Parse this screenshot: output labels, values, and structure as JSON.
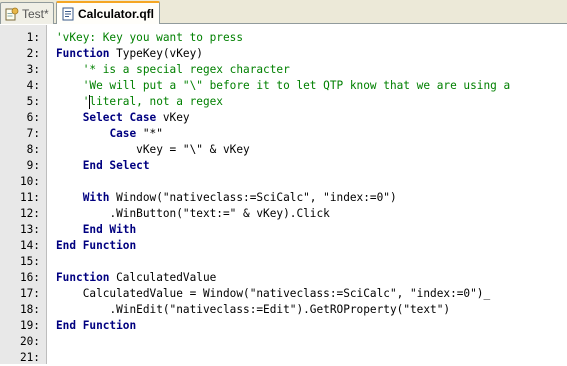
{
  "tabs": [
    {
      "label": "Test*",
      "icon": "script-icon",
      "active": false
    },
    {
      "label": "Calculator.qfl",
      "icon": "function-library-icon",
      "active": true
    }
  ],
  "editor": {
    "lines": [
      {
        "num": "1:",
        "indent": 0,
        "tokens": [
          {
            "t": "'vKey: Key you want to press",
            "c": "cm"
          }
        ]
      },
      {
        "num": "2:",
        "indent": 0,
        "tokens": [
          {
            "t": "Function",
            "c": "kw"
          },
          {
            "t": " TypeKey(vKey)",
            "c": "plain"
          }
        ]
      },
      {
        "num": "3:",
        "indent": 4,
        "tokens": [
          {
            "t": "'* is a special regex character",
            "c": "cm"
          }
        ]
      },
      {
        "num": "4:",
        "indent": 4,
        "tokens": [
          {
            "t": "'We will put a \"\\\" before it to let QTP know that we are using a",
            "c": "cm"
          }
        ]
      },
      {
        "num": "5:",
        "indent": 4,
        "tokens": [
          {
            "t": "'literal, not a regex",
            "c": "cm"
          }
        ]
      },
      {
        "num": "6:",
        "indent": 4,
        "tokens": [
          {
            "t": "Select Case",
            "c": "kw"
          },
          {
            "t": " vKey",
            "c": "plain"
          }
        ]
      },
      {
        "num": "7:",
        "indent": 8,
        "tokens": [
          {
            "t": "Case",
            "c": "kw"
          },
          {
            "t": " \"*\"",
            "c": "plain"
          }
        ]
      },
      {
        "num": "8:",
        "indent": 12,
        "tokens": [
          {
            "t": "vKey = \"\\\" & vKey",
            "c": "plain"
          }
        ]
      },
      {
        "num": "9:",
        "indent": 4,
        "tokens": [
          {
            "t": "End Select",
            "c": "kw"
          }
        ]
      },
      {
        "num": "10:",
        "indent": 0,
        "tokens": []
      },
      {
        "num": "11:",
        "indent": 4,
        "tokens": [
          {
            "t": "With",
            "c": "kw"
          },
          {
            "t": " Window(\"nativeclass:=SciCalc\", \"index:=0\")",
            "c": "plain"
          }
        ]
      },
      {
        "num": "12:",
        "indent": 8,
        "tokens": [
          {
            "t": ".WinButton(\"text:=\" & vKey).Click",
            "c": "plain"
          }
        ]
      },
      {
        "num": "13:",
        "indent": 4,
        "tokens": [
          {
            "t": "End With",
            "c": "kw"
          }
        ]
      },
      {
        "num": "14:",
        "indent": 0,
        "tokens": [
          {
            "t": "End Function",
            "c": "kw"
          }
        ]
      },
      {
        "num": "15:",
        "indent": 0,
        "tokens": []
      },
      {
        "num": "16:",
        "indent": 0,
        "tokens": [
          {
            "t": "Function",
            "c": "kw"
          },
          {
            "t": " CalculatedValue",
            "c": "plain"
          }
        ]
      },
      {
        "num": "17:",
        "indent": 4,
        "tokens": [
          {
            "t": "CalculatedValue = Window(\"nativeclass:=SciCalc\", \"index:=0\")_",
            "c": "plain"
          }
        ]
      },
      {
        "num": "18:",
        "indent": 8,
        "tokens": [
          {
            "t": ".WinEdit(\"nativeclass:=Edit\").GetROProperty(\"text\")",
            "c": "plain"
          }
        ]
      },
      {
        "num": "19:",
        "indent": 0,
        "tokens": [
          {
            "t": "End Function",
            "c": "kw"
          }
        ]
      },
      {
        "num": "20:",
        "indent": 0,
        "tokens": []
      },
      {
        "num": "21:",
        "indent": 0,
        "tokens": []
      }
    ]
  },
  "colors": {
    "keyword": "#000080",
    "comment": "#008000",
    "text": "#000000",
    "gutter": "#e8e8e8",
    "active_tab_accent": "#f5a623"
  }
}
